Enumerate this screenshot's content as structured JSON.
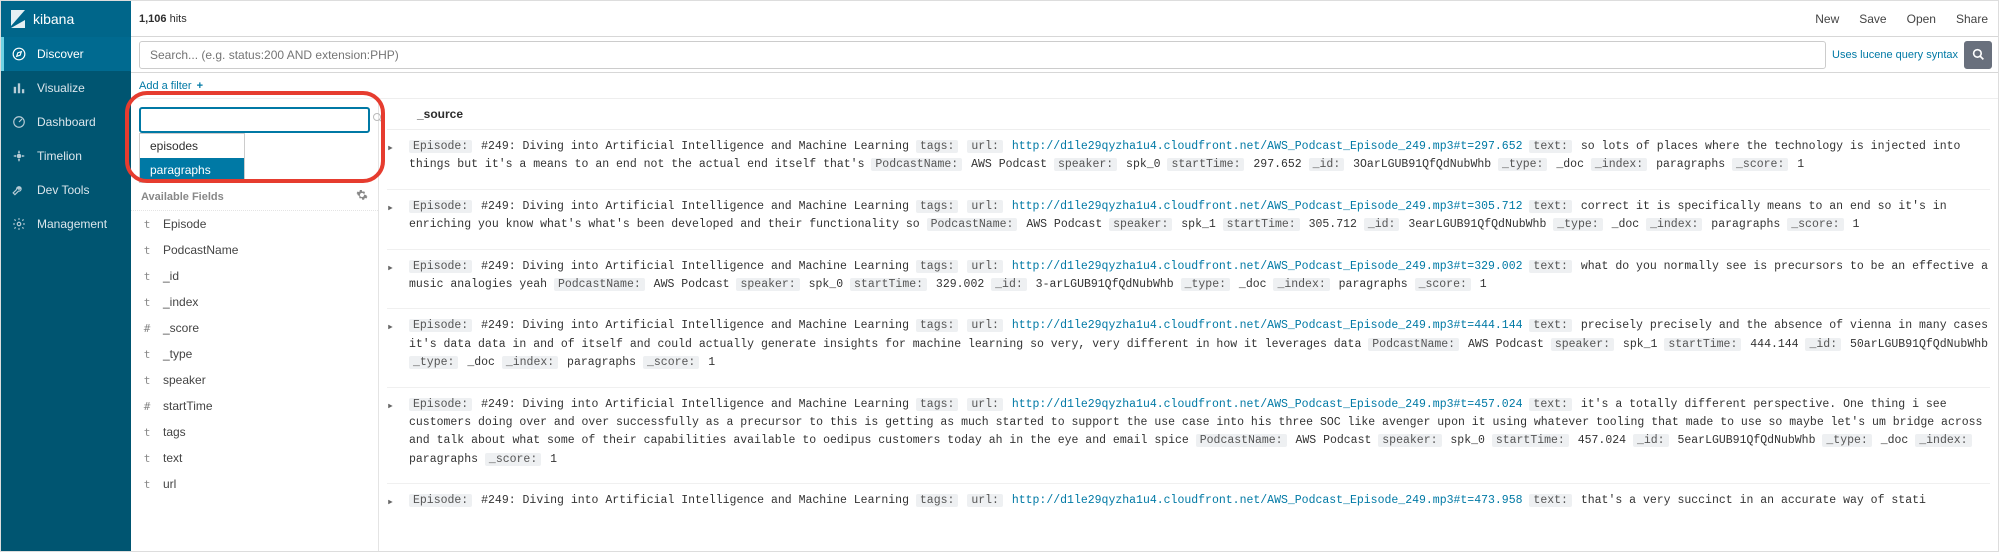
{
  "brand": "kibana",
  "nav": [
    {
      "label": "Discover"
    },
    {
      "label": "Visualize"
    },
    {
      "label": "Dashboard"
    },
    {
      "label": "Timelion"
    },
    {
      "label": "Dev Tools"
    },
    {
      "label": "Management"
    }
  ],
  "hits_value": "1,106",
  "hits_suffix": " hits",
  "toplinks": [
    "New",
    "Save",
    "Open",
    "Share"
  ],
  "query_placeholder": "Search... (e.g. status:200 AND extension:PHP)",
  "lucene_hint": "Uses lucene query syntax",
  "add_filter": "Add a filter",
  "index_input_value": "",
  "index_options": [
    "episodes",
    "paragraphs"
  ],
  "available_fields_label": "Available Fields",
  "fields": [
    {
      "t": "t",
      "n": "Episode"
    },
    {
      "t": "t",
      "n": "PodcastName"
    },
    {
      "t": "t",
      "n": "_id"
    },
    {
      "t": "t",
      "n": "_index"
    },
    {
      "t": "#",
      "n": "_score"
    },
    {
      "t": "t",
      "n": "_type"
    },
    {
      "t": "t",
      "n": "speaker"
    },
    {
      "t": "#",
      "n": "startTime"
    },
    {
      "t": "t",
      "n": "tags"
    },
    {
      "t": "t",
      "n": "text"
    },
    {
      "t": "t",
      "n": "url"
    }
  ],
  "source_header": "_source",
  "keys": {
    "Episode": "Episode:",
    "tags": "tags:",
    "url": "url:",
    "text": "text:",
    "PodcastName": "PodcastName:",
    "speaker": "speaker:",
    "startTime": "startTime:",
    "_id": "_id:",
    "_type": "_type:",
    "_index": "_index:",
    "_score": "_score:"
  },
  "common": {
    "episode_title": "#249: Diving into Artificial Intelligence and Machine Learning",
    "podcast": "AWS Podcast",
    "type_val": "_doc",
    "index_val": "paragraphs",
    "score_val": "1"
  },
  "docs": [
    {
      "url": "http://d1le29qyzha1u4.cloudfront.net/AWS_Podcast_Episode_249.mp3#t=297.652",
      "text": "so lots of places where the technology is injected into things but it's a means to an end not the actual end itself that's",
      "speaker": "spk_0",
      "startTime": "297.652",
      "id": "3OarLGUB91QfQdNubWhb"
    },
    {
      "url": "http://d1le29qyzha1u4.cloudfront.net/AWS_Podcast_Episode_249.mp3#t=305.712",
      "text": "correct it is specifically means to an end so it's in enriching you know what's what's been developed and their functionality so",
      "speaker": "spk_1",
      "startTime": "305.712",
      "id": "3earLGUB91QfQdNubWhb"
    },
    {
      "url": "http://d1le29qyzha1u4.cloudfront.net/AWS_Podcast_Episode_249.mp3#t=329.002",
      "text": "what do you normally see is precursors to be an effective a music analogies yeah",
      "speaker": "spk_0",
      "startTime": "329.002",
      "id": "3-arLGUB91QfQdNubWhb"
    },
    {
      "url": "http://d1le29qyzha1u4.cloudfront.net/AWS_Podcast_Episode_249.mp3#t=444.144",
      "text": "precisely precisely and the absence of vienna in many cases it's data data in and of itself and could actually generate insights for machine learning so very, very different in how it leverages data",
      "speaker": "spk_1",
      "startTime": "444.144",
      "id": "50arLGUB91QfQdNubWhb"
    },
    {
      "url": "http://d1le29qyzha1u4.cloudfront.net/AWS_Podcast_Episode_249.mp3#t=457.024",
      "text": "it's a totally different perspective. One thing i see customers doing over and over successfully as a precursor to this is getting as much started to support the use case into his three SOC like avenger upon it using whatever tooling that made to use so maybe let's um bridge across and talk about what some of their capabilities available to oedipus customers today ah in the eye and email spice",
      "speaker": "spk_0",
      "startTime": "457.024",
      "id": "5earLGUB91QfQdNubWhb"
    },
    {
      "url": "http://d1le29qyzha1u4.cloudfront.net/AWS_Podcast_Episode_249.mp3#t=473.958",
      "text": "that's a very succinct in an accurate way of stati",
      "speaker": "",
      "startTime": "",
      "id": ""
    }
  ]
}
